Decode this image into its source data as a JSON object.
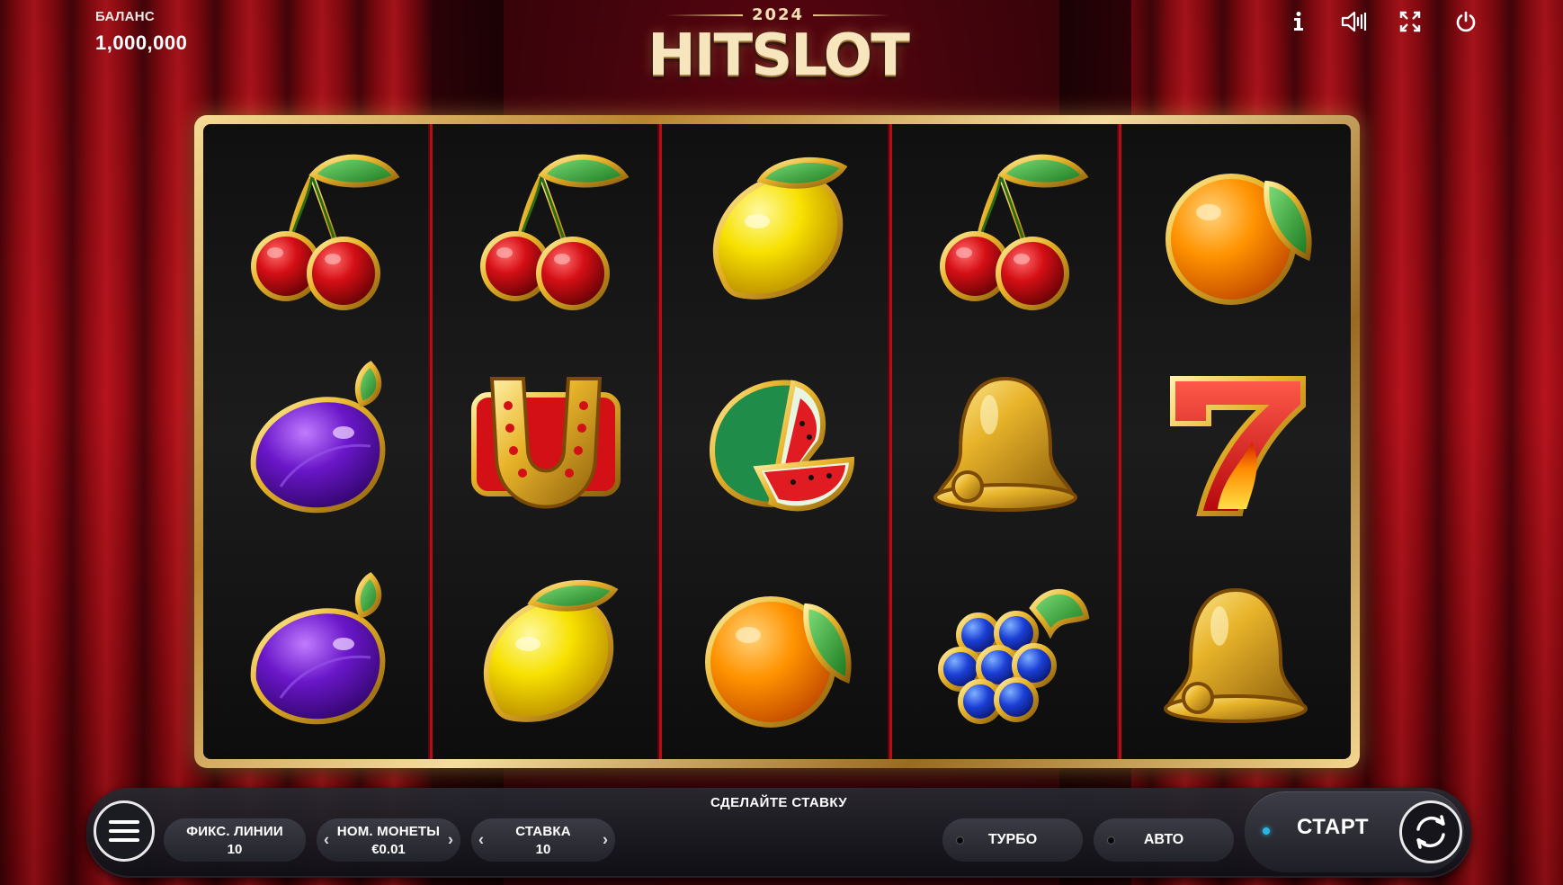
{
  "balance": {
    "label": "БАЛАНС",
    "value": "1,000,000"
  },
  "logo": {
    "year": "2024",
    "title": "HITSLOT"
  },
  "top_icons": [
    "info-icon",
    "sound-icon",
    "fullscreen-icon",
    "power-icon"
  ],
  "reels": [
    [
      "cherry",
      "plum",
      "plum"
    ],
    [
      "cherry",
      "horseshoe",
      "lemon"
    ],
    [
      "lemon",
      "watermelon",
      "orange"
    ],
    [
      "cherry",
      "bell",
      "grapes"
    ],
    [
      "orange",
      "seven",
      "bell"
    ]
  ],
  "bar": {
    "message": "СДЕЛАЙТЕ СТАВКУ",
    "lines": {
      "label": "ФИКС. ЛИНИИ",
      "value": "10"
    },
    "coin": {
      "label": "НОМ. МОНЕТЫ",
      "value": "€0.01"
    },
    "bet": {
      "label": "СТАВКА",
      "value": "10"
    },
    "turbo_label": "ТУРБО",
    "auto_label": "АВТО",
    "start_label": "СТАРТ"
  },
  "colors": {
    "curtain": "#a70c16",
    "frame_gold": "#e8c98a",
    "reel_divider": "#b30d18",
    "start_indicator": "#2ab7e6"
  }
}
